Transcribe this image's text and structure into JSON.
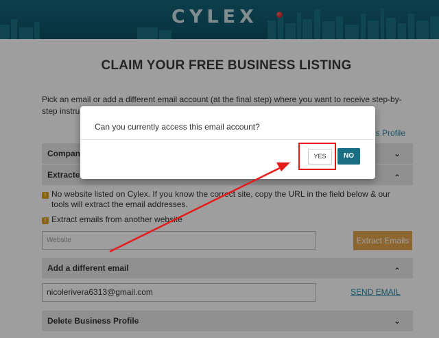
{
  "header": {
    "logo_text": "CYLEX"
  },
  "page": {
    "title": "CLAIM YOUR FREE BUSINESS LISTING",
    "intro": "Pick an email or add a different email account (at the final step) where you want to receive step-by-step instructions to manage your Business Profile",
    "intro_line1": "Pick an email or add a different email account (at the final step) where you want to receive step-by-",
    "intro_line2": "step instru",
    "manage_link_fragment": "ess Profile"
  },
  "accordions": [
    {
      "label": "Compan",
      "chevron": "chevron-down"
    },
    {
      "label": "Extracte",
      "chevron": "chevron-up"
    },
    {
      "label": "Add a different email",
      "chevron": "chevron-up"
    },
    {
      "label": "Delete Business Profile",
      "chevron": "chevron-down"
    }
  ],
  "notes": {
    "no_website": "No website listed on Cylex. If you know the correct site, copy the URL in the field below & our",
    "no_website_cont": "tools will extract the email addresses.",
    "extract_other": "Extract emails from another website"
  },
  "website_field": {
    "placeholder": "Website"
  },
  "extract_button": "Extract Emails",
  "email_field": {
    "value": "nicolerivera6313@gmail.com"
  },
  "send_email_link": "SEND EMAIL",
  "modal": {
    "question": "Can you currently access this email account?",
    "yes_label": "YES",
    "no_label": "NO"
  },
  "colors": {
    "header_teal": "#0f5b6e",
    "accent_teal": "#1a6f84",
    "link_blue": "#2a87a8",
    "extract_orange": "#e4a54d",
    "annotation_red": "#e81919",
    "note_icon": "#e0a21a"
  },
  "chevrons": {
    "down": "⌄",
    "up": "⌃"
  }
}
